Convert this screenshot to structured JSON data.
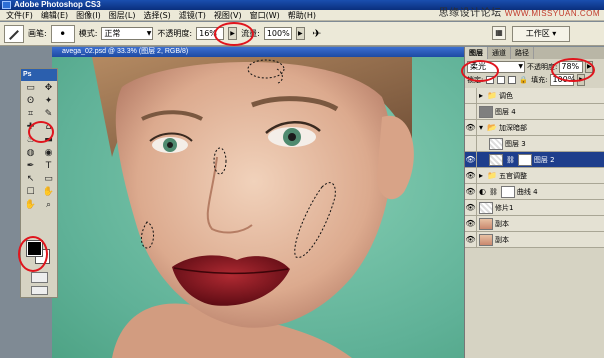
{
  "app": {
    "title": "Adobe Photoshop CS3",
    "watermark": "思缘设计论坛",
    "watermark_url": "WWW.MISSYUAN.COM"
  },
  "menu": [
    "文件(F)",
    "编辑(E)",
    "图像(I)",
    "图层(L)",
    "选择(S)",
    "滤镜(T)",
    "视图(V)",
    "窗口(W)",
    "帮助(H)"
  ],
  "options": {
    "brush_label": "画笔:",
    "mode_label": "模式:",
    "mode_value": "正常",
    "opacity_label": "不透明度:",
    "opacity_value": "16%",
    "flow_label": "流量:",
    "flow_value": "100%",
    "workspace_label": "工作区 ▾"
  },
  "document": {
    "title": "avega_02.psd @ 33.3% (图层 2, RGB/8)"
  },
  "toolbox": {
    "logo": "Ps",
    "tools": [
      "▭",
      "✥",
      "ʘ",
      "✦",
      "⌗",
      "✎",
      "✚",
      "⌂",
      "♨",
      "▬",
      "◍",
      "◉",
      "✒",
      "T",
      "↖",
      "▭",
      "☐",
      "✋",
      "✋",
      "⌕"
    ]
  },
  "layers_panel": {
    "tabs": [
      "图层",
      "通道",
      "路径"
    ],
    "blend_mode": "柔光",
    "opacity_label": "不透明度:",
    "opacity_value": "78%",
    "lock_label": "锁定:",
    "fill_label": "填充:",
    "fill_value": "100%",
    "layers": [
      {
        "name": "调色",
        "kind": "group"
      },
      {
        "name": "图层 4",
        "kind": "layer"
      },
      {
        "name": "加深暗部",
        "kind": "group"
      },
      {
        "name": "图层 3",
        "kind": "layer"
      },
      {
        "name": "图层 2",
        "kind": "layer",
        "selected": true
      },
      {
        "name": "五官调整",
        "kind": "group"
      },
      {
        "name": "曲线 4",
        "kind": "adjustment"
      },
      {
        "name": "修片1",
        "kind": "layer"
      },
      {
        "name": "副本",
        "kind": "layer"
      },
      {
        "name": "副本",
        "kind": "layer"
      }
    ]
  },
  "colors": {
    "annotation": "#e0151d",
    "background": "#5fb197",
    "lips": "#8e1820"
  }
}
